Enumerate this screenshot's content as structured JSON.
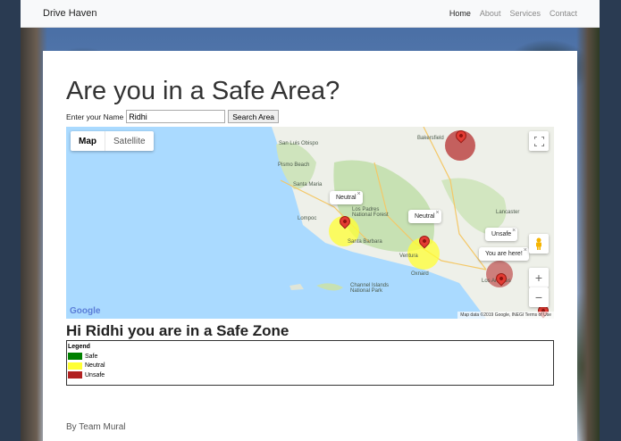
{
  "navbar": {
    "brand": "Drive Haven",
    "links": [
      "Home",
      "About",
      "Services",
      "Contact"
    ]
  },
  "page": {
    "title": "Are you in a Safe Area?",
    "name_label": "Enter your Name",
    "name_value": "Ridhi",
    "search_button": "Search Area"
  },
  "map": {
    "type_map": "Map",
    "type_satellite": "Satellite",
    "info_windows": [
      "Neutral",
      "Neutral",
      "Unsafe",
      "You are here!"
    ],
    "close_glyph": "×",
    "places": [
      "San Luis Obispo",
      "Pismo Beach",
      "Santa Maria",
      "Lompoc",
      "Los Padres National Forest",
      "Santa Barbara",
      "Ventura",
      "Oxnard",
      "Lancaster",
      "Bakersfield",
      "Channel Islands National Park",
      "Los Angeles"
    ],
    "zoom_in": "+",
    "zoom_out": "−",
    "google_logo": "Google",
    "attribution": "Map data ©2019 Google, INEGI   Terms of Use",
    "zone_colors": {
      "safe": "#008000",
      "neutral": "#ffff33",
      "unsafe": "#b22222"
    }
  },
  "result": {
    "message": "Hi Ridhi you are in a Safe Zone"
  },
  "legend": {
    "title": "Legend",
    "items": [
      {
        "label": "Safe",
        "color": "#008000"
      },
      {
        "label": "Neutral",
        "color": "#ffff33"
      },
      {
        "label": "Unsafe",
        "color": "#b22222"
      }
    ]
  },
  "footer": {
    "text": "By Team Mural"
  }
}
